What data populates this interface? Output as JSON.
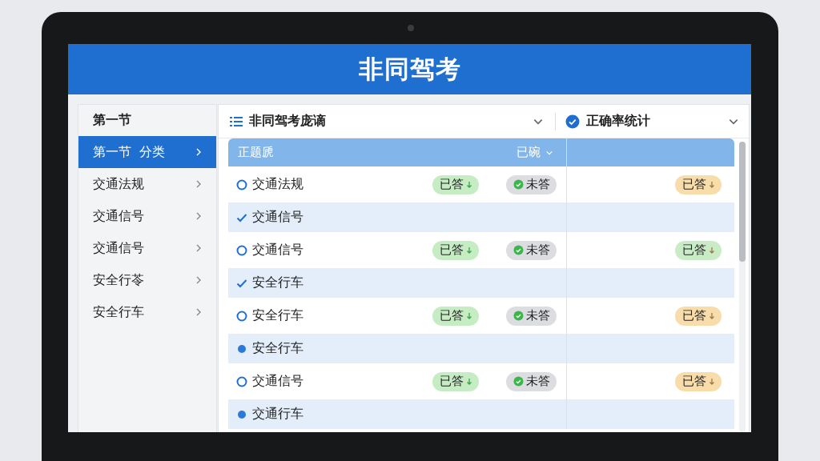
{
  "app_title": "非同驾考",
  "sidebar": {
    "heading": "第一节",
    "items": [
      {
        "label": "第一节  分类",
        "selected": true
      },
      {
        "label": "交通法规",
        "selected": false
      },
      {
        "label": "交通信号",
        "selected": false
      },
      {
        "label": "交通信号",
        "selected": false
      },
      {
        "label": "安全行苓",
        "selected": false
      },
      {
        "label": "安全行车",
        "selected": false
      }
    ]
  },
  "toolbar": {
    "title": "非同驾考庞谪",
    "stats_label": "正确率统计"
  },
  "table": {
    "header": {
      "title": "正题虒",
      "sort_label": "已碗"
    },
    "rows": [
      {
        "kind": "circle",
        "label": "交通法规",
        "answered": "已答",
        "unanswered": "未答",
        "stat": {
          "text": "已答",
          "color": "#f8ddab"
        }
      },
      {
        "kind": "check",
        "label": "交通信号"
      },
      {
        "kind": "circle",
        "label": "交通信号",
        "answered": "已答",
        "unanswered": "未答",
        "stat": {
          "text": "已答",
          "color": "#c9ecc7"
        }
      },
      {
        "kind": "check",
        "label": "安全行车"
      },
      {
        "kind": "circle",
        "label": "安全行车",
        "answered": "已答",
        "unanswered": "未答",
        "stat": {
          "text": "已答",
          "color": "#f8ddab"
        }
      },
      {
        "kind": "dot",
        "label": "安全行车"
      },
      {
        "kind": "circle",
        "label": "交通信号",
        "answered": "已答",
        "unanswered": "未答",
        "stat": {
          "text": "已答",
          "color": "#f8ddab"
        }
      },
      {
        "kind": "dot",
        "label": "交通行车"
      }
    ]
  }
}
